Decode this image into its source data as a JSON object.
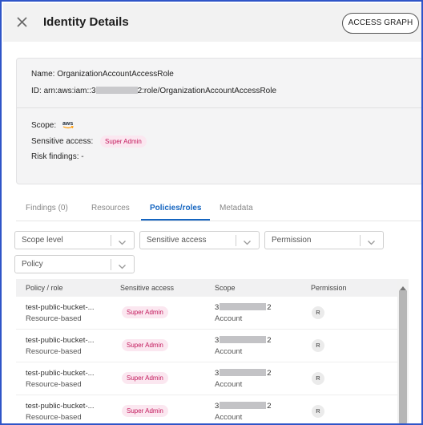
{
  "header": {
    "title": "Identity Details",
    "access_graph_label": "ACCESS GRAPH"
  },
  "identity": {
    "name_label": "Name:",
    "name_value": "OrganizationAccountAccessRole",
    "id_label": "ID:",
    "id_prefix": "arn:aws:iam::3",
    "id_suffix": "2:role/OrganizationAccountAccessRole",
    "scope_label": "Scope:",
    "scope_logo_text": "aws",
    "sensitive_access_label": "Sensitive access:",
    "sensitive_access_badge": "Super Admin",
    "risk_findings_label": "Risk findings:",
    "risk_findings_value": "-"
  },
  "tabs": [
    {
      "label": "Findings (0)",
      "active": false
    },
    {
      "label": "Resources",
      "active": false
    },
    {
      "label": "Policies/roles",
      "active": true
    },
    {
      "label": "Metadata",
      "active": false
    }
  ],
  "filters": {
    "scope_level": "Scope level",
    "sensitive_access": "Sensitive access",
    "permission": "Permission",
    "policy": "Policy"
  },
  "table": {
    "headers": {
      "policy_role": "Policy / role",
      "sensitive_access": "Sensitive access",
      "scope": "Scope",
      "permission": "Permission"
    },
    "rows": [
      {
        "policy": "test-public-bucket-...",
        "type": "Resource-based",
        "sensitive": "Super Admin",
        "scope_prefix": "3",
        "scope_suffix": "2",
        "scope_sub": "Account",
        "permission": "R"
      },
      {
        "policy": "test-public-bucket-...",
        "type": "Resource-based",
        "sensitive": "Super Admin",
        "scope_prefix": "3",
        "scope_suffix": "2",
        "scope_sub": "Account",
        "permission": "R"
      },
      {
        "policy": "test-public-bucket-...",
        "type": "Resource-based",
        "sensitive": "Super Admin",
        "scope_prefix": "3",
        "scope_suffix": "2",
        "scope_sub": "Account",
        "permission": "R"
      },
      {
        "policy": "test-public-bucket-...",
        "type": "Resource-based",
        "sensitive": "Super Admin",
        "scope_prefix": "3",
        "scope_suffix": "2",
        "scope_sub": "Account",
        "permission": "R"
      }
    ]
  },
  "colors": {
    "accent": "#1565c0",
    "badge_text": "#c2185b",
    "badge_bg": "#fbe7f0",
    "frame_border": "#2f55c8"
  },
  "icons": {
    "close": "close-icon",
    "chevron": "chevron-down-icon",
    "scope_logo": "aws-logo-icon",
    "scroll_up": "scroll-up-arrow-icon"
  }
}
